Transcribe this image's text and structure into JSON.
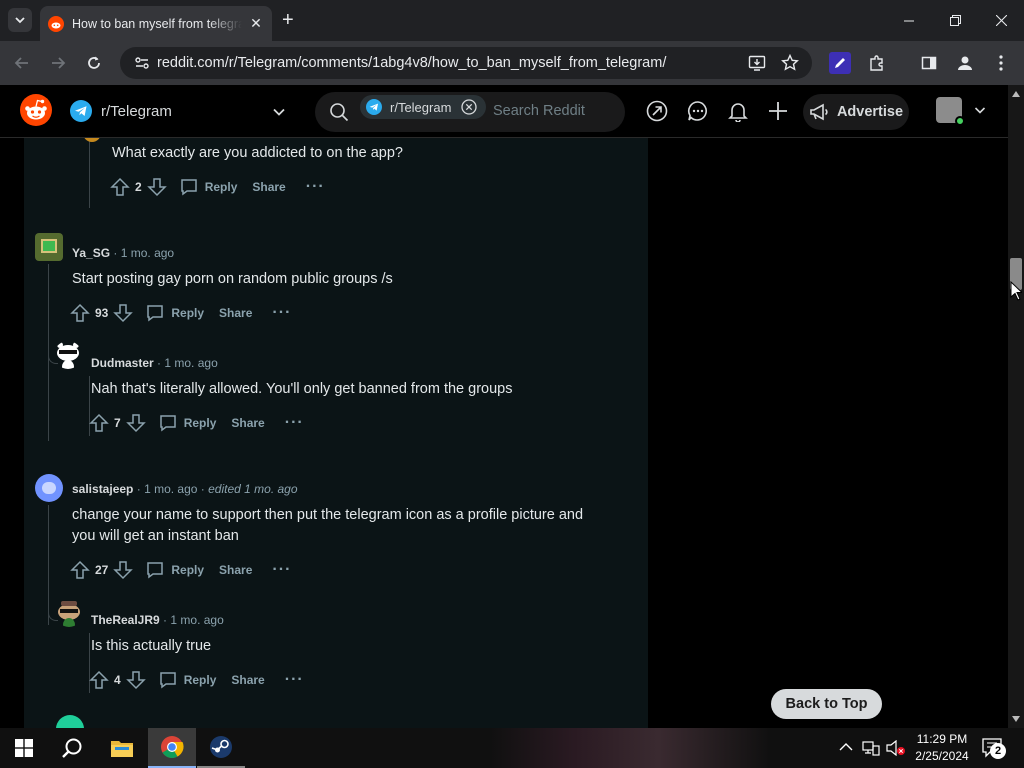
{
  "browser": {
    "tab_title": "How to ban myself from telegram",
    "url": "reddit.com/r/Telegram/comments/1abg4v8/how_to_ban_myself_from_telegram/"
  },
  "header": {
    "community": "r/Telegram",
    "search_chip": "r/Telegram",
    "search_placeholder": "Search Reddit",
    "advertise_label": "Advertise"
  },
  "comments": [
    {
      "author": "",
      "body": "What exactly are you addicted to on the app?",
      "votes": "2",
      "reply_label": "Reply",
      "share_label": "Share"
    },
    {
      "author": "Ya_SG",
      "time": "1 mo. ago",
      "body": "Start posting gay porn on random public groups /s",
      "votes": "93",
      "reply_label": "Reply",
      "share_label": "Share"
    },
    {
      "author": "Dudmaster",
      "time": "1 mo. ago",
      "body": "Nah that's literally allowed. You'll only get banned from the groups",
      "votes": "7",
      "reply_label": "Reply",
      "share_label": "Share"
    },
    {
      "author": "salistajeep",
      "time": "1 mo. ago",
      "edited": "edited 1 mo. ago",
      "body": "change your name to support then put the telegram icon as a profile picture and you will get an instant ban",
      "votes": "27",
      "reply_label": "Reply",
      "share_label": "Share"
    },
    {
      "author": "TheRealJR9",
      "time": "1 mo. ago",
      "body": "Is this actually true",
      "votes": "4",
      "reply_label": "Reply",
      "share_label": "Share"
    }
  ],
  "back_to_top_label": "Back to Top",
  "taskbar": {
    "time": "11:29 PM",
    "date": "2/25/2024",
    "notification_count": "2"
  },
  "colors": {
    "reddit_orange": "#ff4500",
    "telegram_blue": "#2aabee",
    "feed_bg": "#0b1416"
  }
}
